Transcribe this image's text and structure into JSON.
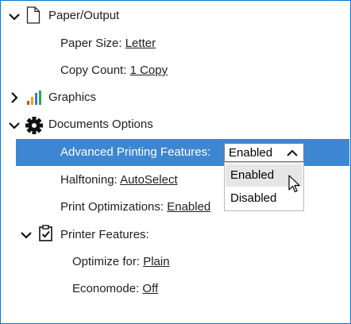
{
  "tree": {
    "paper_output": {
      "label": "Paper/Output",
      "expanded": true,
      "icon": "document-icon"
    },
    "paper_size": {
      "label": "Paper Size:",
      "value": "Letter"
    },
    "copy_count": {
      "label": "Copy Count:",
      "value": "1 Copy"
    },
    "graphics": {
      "label": "Graphics",
      "expanded": false,
      "icon": "bar-chart-icon"
    },
    "documents_options": {
      "label": "Documents Options",
      "expanded": true,
      "icon": "gear-icon"
    },
    "advanced_printing": {
      "label": "Advanced Printing Features:",
      "selected": true
    },
    "halftoning": {
      "label": "Halftoning:",
      "value": "AutoSelect"
    },
    "print_optimizations": {
      "label": "Print Optimizations:",
      "value": "Enabled"
    },
    "printer_features": {
      "label": "Printer Features:",
      "expanded": true,
      "icon": "checklist-icon"
    },
    "optimize_for": {
      "label": "Optimize for:",
      "value": "Plain"
    },
    "economode": {
      "label": "Economode:",
      "value": "Off"
    }
  },
  "combo": {
    "value": "Enabled",
    "options": [
      "Enabled",
      "Disabled"
    ],
    "hovered_option": "Enabled"
  },
  "colors": {
    "selection": "#3d86d3",
    "frame_border": "#0078d7",
    "hover": "#e6e6e6"
  }
}
